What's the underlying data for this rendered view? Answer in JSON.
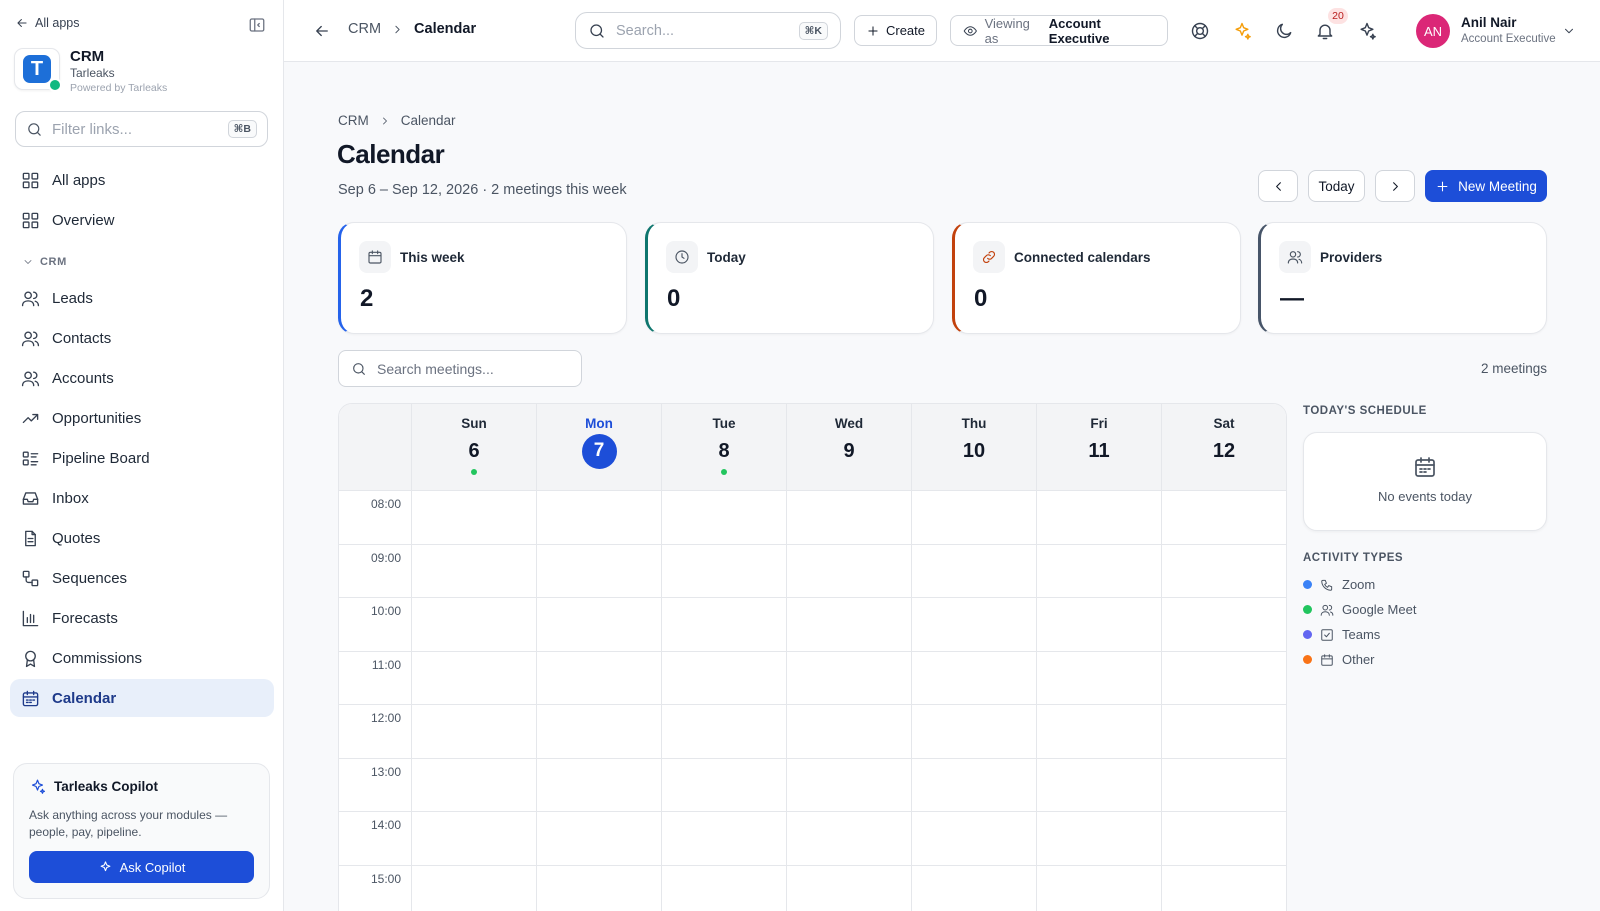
{
  "sidebar": {
    "back_label": "All apps",
    "brand": {
      "name": "CRM",
      "org": "Tarleaks",
      "powered": "Powered by Tarleaks",
      "logo_letter": "T"
    },
    "filter": {
      "placeholder": "Filter links...",
      "shortcut": "⌘B"
    },
    "top_items": [
      {
        "label": "All apps",
        "icon": "grid-icon"
      },
      {
        "label": "Overview",
        "icon": "grid-icon"
      }
    ],
    "section_label": "CRM",
    "items": [
      {
        "label": "Leads",
        "icon": "users-icon"
      },
      {
        "label": "Contacts",
        "icon": "users-icon"
      },
      {
        "label": "Accounts",
        "icon": "users-icon"
      },
      {
        "label": "Opportunities",
        "icon": "trending-up-icon"
      },
      {
        "label": "Pipeline Board",
        "icon": "list-icon"
      },
      {
        "label": "Inbox",
        "icon": "inbox-icon"
      },
      {
        "label": "Quotes",
        "icon": "file-icon"
      },
      {
        "label": "Sequences",
        "icon": "workflow-icon"
      },
      {
        "label": "Forecasts",
        "icon": "bar-chart-icon"
      },
      {
        "label": "Commissions",
        "icon": "award-icon"
      },
      {
        "label": "Calendar",
        "icon": "calendar-icon",
        "active": true
      }
    ],
    "copilot": {
      "title": "Tarleaks Copilot",
      "description": "Ask anything across your modules — people, pay, pipeline.",
      "button": "Ask Copilot"
    }
  },
  "topbar": {
    "breadcrumb": [
      "CRM",
      "Calendar"
    ],
    "search": {
      "placeholder": "Search...",
      "shortcut": "⌘K"
    },
    "create_label": "Create",
    "viewing_prefix": "Viewing as",
    "viewing_role": "Account Executive",
    "notifications_count": "20",
    "user": {
      "initials": "AN",
      "name": "Anil Nair",
      "role": "Account Executive"
    }
  },
  "main": {
    "breadcrumb": [
      "CRM",
      "Calendar"
    ],
    "title": "Calendar",
    "subtitle": "Sep 6 – Sep 12, 2026 · 2 meetings this week",
    "today_label": "Today",
    "new_meeting_label": "New Meeting",
    "stats": [
      {
        "label": "This week",
        "value": "2",
        "icon": "calendar-icon",
        "color": "#2563eb"
      },
      {
        "label": "Today",
        "value": "0",
        "icon": "clock-icon",
        "color": "#0f766e"
      },
      {
        "label": "Connected calendars",
        "value": "0",
        "icon": "link-icon",
        "color": "#c2410c"
      },
      {
        "label": "Providers",
        "value": "—",
        "icon": "users-icon",
        "color": "#475569"
      }
    ],
    "meeting_search_placeholder": "Search meetings...",
    "meetings_count": "2 meetings",
    "days": [
      {
        "name": "Sun",
        "date": "6",
        "has_event": true
      },
      {
        "name": "Mon",
        "date": "7",
        "today": true
      },
      {
        "name": "Tue",
        "date": "8",
        "has_event": true
      },
      {
        "name": "Wed",
        "date": "9"
      },
      {
        "name": "Thu",
        "date": "10"
      },
      {
        "name": "Fri",
        "date": "11"
      },
      {
        "name": "Sat",
        "date": "12"
      }
    ],
    "hours": [
      "08:00",
      "09:00",
      "10:00",
      "11:00",
      "12:00",
      "13:00",
      "14:00",
      "15:00"
    ]
  },
  "right_panel": {
    "schedule_title": "TODAY'S SCHEDULE",
    "no_events": "No events today",
    "activity_title": "ACTIVITY TYPES",
    "activity_types": [
      {
        "label": "Zoom",
        "color": "#3b82f6",
        "icon": "phone-icon"
      },
      {
        "label": "Google Meet",
        "color": "#22c55e",
        "icon": "users-icon"
      },
      {
        "label": "Teams",
        "color": "#6366f1",
        "icon": "check-square-icon"
      },
      {
        "label": "Other",
        "color": "#f97316",
        "icon": "calendar-icon"
      }
    ]
  }
}
